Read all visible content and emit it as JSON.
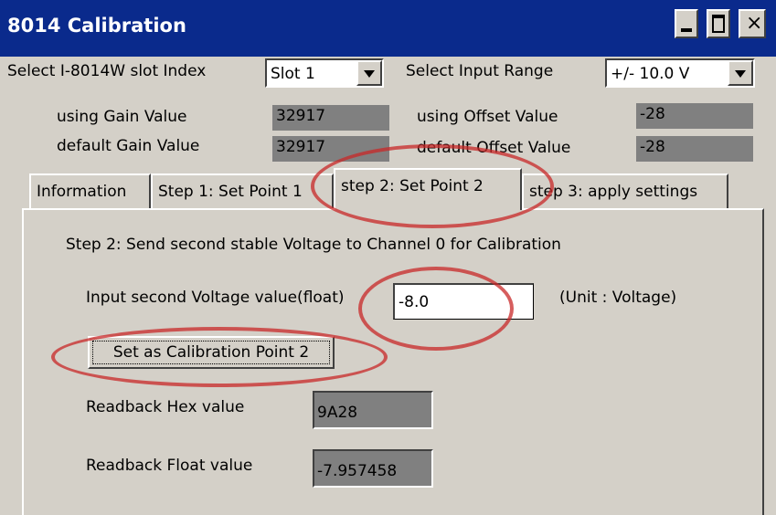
{
  "window": {
    "title": "8014 Calibration",
    "close_glyph": "×"
  },
  "settings": {
    "slot_label": "Select I-8014W slot Index",
    "slot_value": "Slot 1",
    "range_label": "Select Input Range",
    "range_value": "+/- 10.0 V",
    "using_gain_label": "using Gain Value",
    "using_gain_value": "32917",
    "default_gain_label": "default Gain Value",
    "default_gain_value": "32917",
    "using_offset_label": "using Offset Value",
    "using_offset_value": "-28",
    "default_offset_label": "default Offset Value",
    "default_offset_value": "-28"
  },
  "tabs": [
    {
      "label": "Information"
    },
    {
      "label": "Step 1: Set Point 1"
    },
    {
      "label": "step 2: Set Point 2"
    },
    {
      "label": "step 3: apply settings"
    }
  ],
  "step2": {
    "instruction": "Step 2: Send second stable Voltage to Channel 0 for Calibration",
    "input_label": "Input second Voltage value(float)",
    "input_value": "-8.0",
    "unit_label": "(Unit : Voltage)",
    "set_button": "Set as Calibration Point 2",
    "hex_label": "Readback Hex value",
    "hex_value": "9A28",
    "float_label": "Readback Float value",
    "float_value": "-7.957458"
  },
  "colors": {
    "titlebar": "#0a2a8c",
    "face": "#d4d0c8",
    "highlight": "#c82828"
  }
}
